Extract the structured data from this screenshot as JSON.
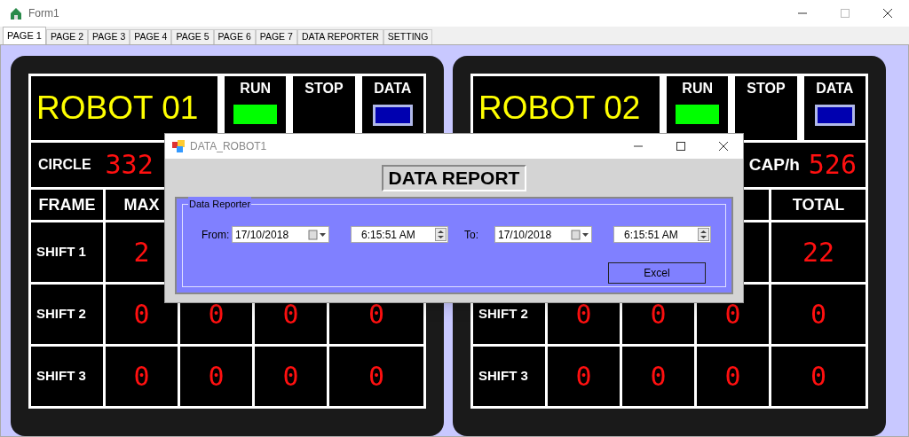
{
  "window": {
    "title": "Form1"
  },
  "tabs": [
    {
      "label": "PAGE 1",
      "selected": true
    },
    {
      "label": "PAGE 2",
      "selected": false
    },
    {
      "label": "PAGE 3",
      "selected": false
    },
    {
      "label": "PAGE 4",
      "selected": false
    },
    {
      "label": "PAGE 5",
      "selected": false
    },
    {
      "label": "PAGE 6",
      "selected": false
    },
    {
      "label": "PAGE 7",
      "selected": false
    },
    {
      "label": "DATA REPORTER",
      "selected": false
    },
    {
      "label": "SETTING",
      "selected": false
    }
  ],
  "panels": [
    {
      "title": "ROBOT 01",
      "indicators": [
        {
          "kind": "lamp",
          "label": "RUN",
          "on": true
        },
        {
          "kind": "lamp",
          "label": "STOP",
          "on": false
        },
        {
          "kind": "button",
          "label": "DATA"
        }
      ],
      "circle": {
        "label": "CIRCLE",
        "value": "332"
      },
      "header": {
        "frame": "FRAME",
        "max": "MAX"
      },
      "rows": [
        {
          "frame": "SHIFT 1",
          "max": "2"
        },
        {
          "frame": "SHIFT 2",
          "max": "0",
          "column_3": "0",
          "column_4": "0",
          "total": "0"
        },
        {
          "frame": "SHIFT 3",
          "max": "0",
          "column_3": "0",
          "column_4": "0",
          "total": "0"
        }
      ]
    },
    {
      "title": "ROBOT 02",
      "indicators": [
        {
          "kind": "lamp",
          "label": "RUN",
          "on": true
        },
        {
          "kind": "lamp",
          "label": "STOP",
          "on": false
        },
        {
          "kind": "button",
          "label": "DATA"
        }
      ],
      "capacity": {
        "label": "CAP/h",
        "value": "526"
      },
      "header": {
        "total": "TOTAL"
      },
      "rows": [
        {
          "total": "22"
        },
        {
          "frame": "SHIFT 2",
          "max": "0",
          "column_3": "0",
          "column_4": "0",
          "total": "0"
        },
        {
          "frame": "SHIFT 3",
          "max": "0",
          "column_3": "0",
          "column_4": "0",
          "total": "0"
        }
      ]
    }
  ],
  "dialog": {
    "title": "DATA_ROBOT1",
    "heading": "DATA REPORT",
    "group_title": "Data Reporter",
    "from": {
      "label": "From:",
      "date": "17/10/2018",
      "time": "6:15:51 AM"
    },
    "to": {
      "label": "To:",
      "date": "17/10/2018",
      "time": "6:15:51 AM"
    },
    "button": "Excel"
  }
}
